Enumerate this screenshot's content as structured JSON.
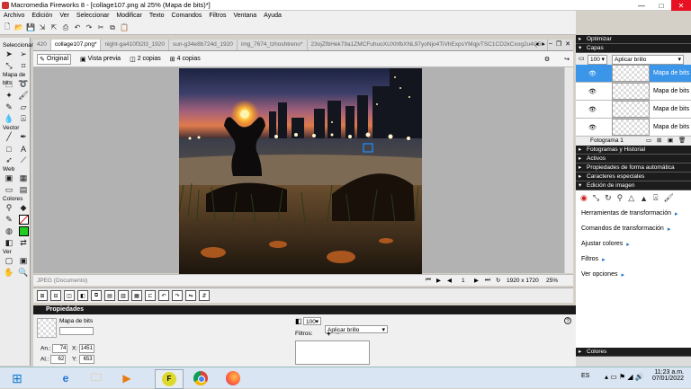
{
  "window": {
    "title": "Macromedia Fireworks 8 - [collage107.png al  25% (Mapa de bits)*]"
  },
  "menu": [
    "Archivo",
    "Edición",
    "Ver",
    "Seleccionar",
    "Modificar",
    "Texto",
    "Comandos",
    "Filtros",
    "Ventana",
    "Ayuda"
  ],
  "tools": {
    "section_select": "Seleccionar",
    "section_bitmap": "Mapa de bits",
    "section_vector": "Vector",
    "section_web": "Web",
    "section_colors": "Colores",
    "section_view": "Ver"
  },
  "tabs": [
    {
      "label": "420"
    },
    {
      "label": "collage107.png*"
    },
    {
      "label": "night-ga410f32l3_1920"
    },
    {
      "label": "sun-g34e8b724d_1920"
    },
    {
      "label": "img_7674_tzhoshtreno*"
    },
    {
      "label": "23ojZfbHek79a1ZMCFuhuoXUXhfbXNL97yoNjo4TiVhExpsYMqjvTSC1CD2kCxog2u4Q5*"
    }
  ],
  "view": {
    "original": "Original",
    "preview": "Vista previa",
    "two_up": "2 copias",
    "four_up": "4 copias"
  },
  "status": {
    "format": "JPEG (Documento)",
    "frame": "1",
    "size": "1920 x 1720",
    "zoom": "25%"
  },
  "properties": {
    "header": "Propiedades",
    "object_type": "Mapa de bits",
    "width_label": "An.:",
    "width": "74",
    "height_label": "Al.:",
    "height": "62",
    "x_label": "X:",
    "x": "1451",
    "y_label": "Y:",
    "y": "653",
    "opacity": "100",
    "blend": "Aplicar brillo",
    "filters_label": "Filtros:",
    "filter_add": "+",
    "filter_remove": "−"
  },
  "right_panel": {
    "optimize": "Optimizar",
    "layers": "Capas",
    "layer_opacity": "100",
    "layer_blend": "Aplicar brillo",
    "layers_list": [
      {
        "name": "Mapa de bits",
        "selected": true
      },
      {
        "name": "Mapa de bits",
        "selected": false
      },
      {
        "name": "Mapa de bits",
        "selected": false
      },
      {
        "name": "Mapa de bits",
        "selected": false
      }
    ],
    "frame_label": "Fotograma 1",
    "frames_history": "Fotogramas y Historial",
    "assets": "Activos",
    "auto_shape_props": "Propiedades de forma automática",
    "special_chars": "Caracteres especiales",
    "image_editing": "Edición de imagen",
    "links": [
      "Herramientas de transformación",
      "Comandos de transformación",
      "Ajustar colores",
      "Filtros",
      "Ver opciones"
    ],
    "colors": "Colores"
  },
  "taskbar": {
    "lang": "ES",
    "time": "11:23 a.m.",
    "date": "07/01/2022"
  },
  "colors": {
    "accent": "#3b95e8",
    "stroke": "#e02020",
    "fill": "#22cc22"
  }
}
